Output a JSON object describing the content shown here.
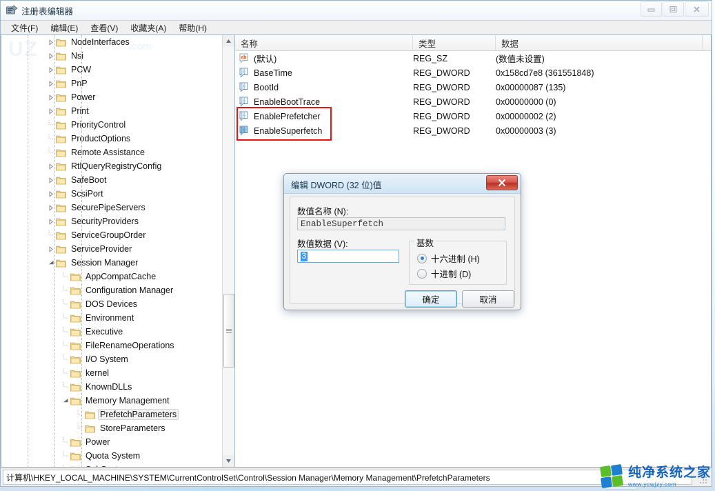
{
  "window": {
    "title": "注册表编辑器",
    "icon": "registry-editor-icon",
    "controls": {
      "minimize": "minimize-icon",
      "restore": "restore-icon",
      "close": "close-icon"
    }
  },
  "menubar": {
    "items": [
      {
        "label": "文件(F)",
        "name": "menu-file"
      },
      {
        "label": "编辑(E)",
        "name": "menu-edit"
      },
      {
        "label": "查看(V)",
        "name": "menu-view"
      },
      {
        "label": "收藏夹(A)",
        "name": "menu-favorites"
      },
      {
        "label": "帮助(H)",
        "name": "menu-help"
      }
    ]
  },
  "tree": {
    "watermark": "UZ",
    "watermark2": ".com",
    "nodes": [
      {
        "label": "NodeInterfaces",
        "indent": 3,
        "arrow": "collapsed",
        "selected": false
      },
      {
        "label": "Nsi",
        "indent": 3,
        "arrow": "collapsed",
        "selected": false
      },
      {
        "label": "PCW",
        "indent": 3,
        "arrow": "collapsed",
        "selected": false
      },
      {
        "label": "PnP",
        "indent": 3,
        "arrow": "collapsed",
        "selected": false
      },
      {
        "label": "Power",
        "indent": 3,
        "arrow": "collapsed",
        "selected": false
      },
      {
        "label": "Print",
        "indent": 3,
        "arrow": "collapsed",
        "selected": false
      },
      {
        "label": "PriorityControl",
        "indent": 3,
        "arrow": "none",
        "selected": false
      },
      {
        "label": "ProductOptions",
        "indent": 3,
        "arrow": "none",
        "selected": false
      },
      {
        "label": "Remote Assistance",
        "indent": 3,
        "arrow": "none",
        "selected": false
      },
      {
        "label": "RtlQueryRegistryConfig",
        "indent": 3,
        "arrow": "collapsed",
        "selected": false
      },
      {
        "label": "SafeBoot",
        "indent": 3,
        "arrow": "collapsed",
        "selected": false
      },
      {
        "label": "ScsiPort",
        "indent": 3,
        "arrow": "collapsed",
        "selected": false
      },
      {
        "label": "SecurePipeServers",
        "indent": 3,
        "arrow": "collapsed",
        "selected": false
      },
      {
        "label": "SecurityProviders",
        "indent": 3,
        "arrow": "collapsed",
        "selected": false
      },
      {
        "label": "ServiceGroupOrder",
        "indent": 3,
        "arrow": "none",
        "selected": false
      },
      {
        "label": "ServiceProvider",
        "indent": 3,
        "arrow": "collapsed",
        "selected": false
      },
      {
        "label": "Session Manager",
        "indent": 3,
        "arrow": "expanded",
        "selected": false
      },
      {
        "label": "AppCompatCache",
        "indent": 4,
        "arrow": "none",
        "selected": false
      },
      {
        "label": "Configuration Manager",
        "indent": 4,
        "arrow": "none",
        "selected": false
      },
      {
        "label": "DOS Devices",
        "indent": 4,
        "arrow": "none",
        "selected": false
      },
      {
        "label": "Environment",
        "indent": 4,
        "arrow": "none",
        "selected": false
      },
      {
        "label": "Executive",
        "indent": 4,
        "arrow": "none",
        "selected": false
      },
      {
        "label": "FileRenameOperations",
        "indent": 4,
        "arrow": "none",
        "selected": false
      },
      {
        "label": "I/O System",
        "indent": 4,
        "arrow": "none",
        "selected": false
      },
      {
        "label": "kernel",
        "indent": 4,
        "arrow": "none",
        "selected": false
      },
      {
        "label": "KnownDLLs",
        "indent": 4,
        "arrow": "none",
        "selected": false
      },
      {
        "label": "Memory Management",
        "indent": 4,
        "arrow": "expanded",
        "selected": false
      },
      {
        "label": "PrefetchParameters",
        "indent": 5,
        "arrow": "none",
        "selected": true
      },
      {
        "label": "StoreParameters",
        "indent": 5,
        "arrow": "none",
        "selected": false
      },
      {
        "label": "Power",
        "indent": 4,
        "arrow": "none",
        "selected": false
      },
      {
        "label": "Quota System",
        "indent": 4,
        "arrow": "none",
        "selected": false
      },
      {
        "label": "SubSystems",
        "indent": 4,
        "arrow": "none",
        "selected": false
      }
    ]
  },
  "list": {
    "columns": [
      {
        "label": "名称",
        "name": "column-name"
      },
      {
        "label": "类型",
        "name": "column-type"
      },
      {
        "label": "数据",
        "name": "column-data"
      }
    ],
    "rows": [
      {
        "icon": "reg-string-icon",
        "name": "(默认)",
        "type": "REG_SZ",
        "data": "(数值未设置)",
        "highlighted": false,
        "selected": false
      },
      {
        "icon": "reg-dword-icon",
        "name": "BaseTime",
        "type": "REG_DWORD",
        "data": "0x158cd7e8 (361551848)",
        "highlighted": false,
        "selected": false
      },
      {
        "icon": "reg-dword-icon",
        "name": "BootId",
        "type": "REG_DWORD",
        "data": "0x00000087 (135)",
        "highlighted": false,
        "selected": false
      },
      {
        "icon": "reg-dword-icon",
        "name": "EnableBootTrace",
        "type": "REG_DWORD",
        "data": "0x00000000 (0)",
        "highlighted": false,
        "selected": false
      },
      {
        "icon": "reg-dword-icon",
        "name": "EnablePrefetcher",
        "type": "REG_DWORD",
        "data": "0x00000002 (2)",
        "highlighted": true,
        "selected": false
      },
      {
        "icon": "reg-dword-icon",
        "name": "EnableSuperfetch",
        "type": "REG_DWORD",
        "data": "0x00000003 (3)",
        "highlighted": true,
        "selected": true
      }
    ],
    "highlight_color": "#ee1111"
  },
  "statusbar": {
    "path": "计算机\\HKEY_LOCAL_MACHINE\\SYSTEM\\CurrentControlSet\\Control\\Session Manager\\Memory Management\\PrefetchParameters"
  },
  "dialog": {
    "title": "编辑 DWORD (32 位)值",
    "close_icon": "close-icon",
    "value_name_label": "数值名称 (N):",
    "value_name": "EnableSuperfetch",
    "value_data_label": "数值数据 (V):",
    "value_data": "3",
    "base_group_label": "基数",
    "radios": [
      {
        "label": "十六进制 (H)",
        "selected": true,
        "name": "radio-hexadecimal"
      },
      {
        "label": "十进制 (D)",
        "selected": false,
        "name": "radio-decimal"
      }
    ],
    "ok_label": "确定",
    "cancel_label": "取消"
  },
  "watermark": {
    "title": "纯净系统之家",
    "url": "www.ycwjzy.com",
    "colors": {
      "green": "#5bbd2a",
      "blue": "#1f7fd0",
      "teal": "#2aa34a",
      "deep": "#1565c0"
    }
  }
}
